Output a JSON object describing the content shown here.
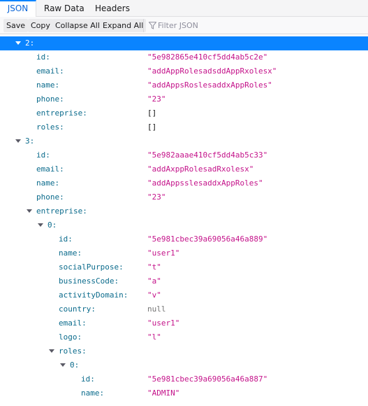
{
  "tabs": [
    "JSON",
    "Raw Data",
    "Headers"
  ],
  "toolbar": {
    "save": "Save",
    "copy": "Copy",
    "collapse_all": "Collapse All",
    "expand_all": "Expand All",
    "filter_placeholder": "Filter JSON"
  },
  "colors": {
    "selected_row": "#0a84ff",
    "key": "#0b6b8c",
    "string_value": "#c4138a",
    "null_value": "#737373"
  },
  "tree": [
    {
      "key": "2:",
      "value": "",
      "depth": 0,
      "expander": true,
      "selected": true
    },
    {
      "key": "id:",
      "value": "\"5e982865e410cf5dd4ab5c2e\"",
      "type": "str",
      "depth": 1
    },
    {
      "key": "email:",
      "value": "\"addAppRolesadsddAppRxolesx\"",
      "type": "str",
      "depth": 1
    },
    {
      "key": "name:",
      "value": "\"addAppsRoslesaddxAppRoles\"",
      "type": "str",
      "depth": 1
    },
    {
      "key": "phone:",
      "value": "\"23\"",
      "type": "str",
      "depth": 1
    },
    {
      "key": "entreprise:",
      "value": "[]",
      "type": "arr",
      "depth": 1
    },
    {
      "key": "roles:",
      "value": "[]",
      "type": "arr",
      "depth": 1
    },
    {
      "key": "3:",
      "value": "",
      "depth": 0,
      "expander": true
    },
    {
      "key": "id:",
      "value": "\"5e982aaae410cf5dd4ab5c33\"",
      "type": "str",
      "depth": 1
    },
    {
      "key": "email:",
      "value": "\"addAxppRolesadRxolesx\"",
      "type": "str",
      "depth": 1
    },
    {
      "key": "name:",
      "value": "\"addAppsslesaddxAppRoles\"",
      "type": "str",
      "depth": 1
    },
    {
      "key": "phone:",
      "value": "\"23\"",
      "type": "str",
      "depth": 1
    },
    {
      "key": "entreprise:",
      "value": "",
      "depth": 1,
      "expander": true
    },
    {
      "key": "0:",
      "value": "",
      "depth": 2,
      "expander": true
    },
    {
      "key": "id:",
      "value": "\"5e981cbec39a69056a46a889\"",
      "type": "str",
      "depth": 3
    },
    {
      "key": "name:",
      "value": "\"user1\"",
      "type": "str",
      "depth": 3
    },
    {
      "key": "socialPurpose:",
      "value": "\"t\"",
      "type": "str",
      "depth": 3
    },
    {
      "key": "businessCode:",
      "value": "\"a\"",
      "type": "str",
      "depth": 3
    },
    {
      "key": "activityDomain:",
      "value": "\"v\"",
      "type": "str",
      "depth": 3
    },
    {
      "key": "country:",
      "value": "null",
      "type": "null",
      "depth": 3
    },
    {
      "key": "email:",
      "value": "\"user1\"",
      "type": "str",
      "depth": 3
    },
    {
      "key": "logo:",
      "value": "\"l\"",
      "type": "str",
      "depth": 3
    },
    {
      "key": "roles:",
      "value": "",
      "depth": 3,
      "expander": true
    },
    {
      "key": "0:",
      "value": "",
      "depth": 4,
      "expander": true
    },
    {
      "key": "id:",
      "value": "\"5e981cbec39a69056a46a887\"",
      "type": "str",
      "depth": 5
    },
    {
      "key": "name:",
      "value": "\"ADMIN\"",
      "type": "str",
      "depth": 5
    }
  ]
}
